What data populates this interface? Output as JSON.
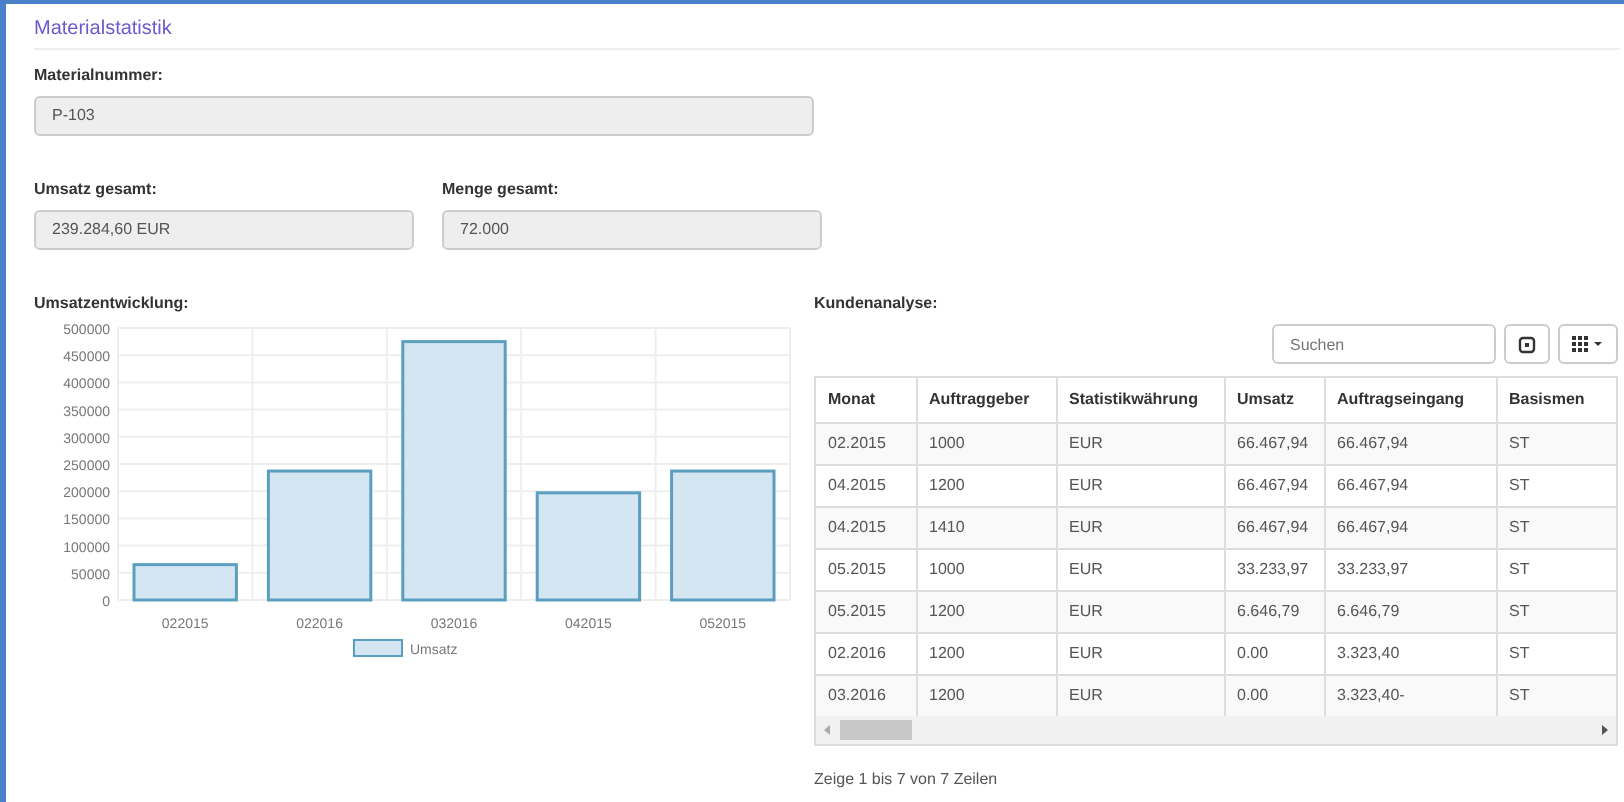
{
  "title": "Materialstatistik",
  "material": {
    "label": "Materialnummer:",
    "value": "P-103"
  },
  "totals": [
    {
      "label": "Umsatz gesamt:",
      "value": "239.284,60 EUR"
    },
    {
      "label": "Menge gesamt:",
      "value": "72.000"
    }
  ],
  "chart_section": {
    "label": "Umsatzentwicklung:",
    "chart_data": {
      "type": "bar",
      "categories": [
        "022015",
        "022016",
        "032016",
        "042015",
        "052015"
      ],
      "series": [
        {
          "name": "Umsatz",
          "color": "#d4e6f1",
          "values": [
            65000,
            237000,
            475000,
            197000,
            237000
          ]
        }
      ],
      "ylim": [
        0,
        500000
      ],
      "grid": true,
      "yticks": [
        0,
        50000,
        100000,
        150000,
        200000,
        250000,
        300000,
        350000,
        400000,
        450000,
        500000
      ]
    }
  },
  "customer_section": {
    "label": "Kundenanalyse:",
    "search": {
      "placeholder": "Suchen"
    },
    "table": {
      "columns": [
        "Monat",
        "Auftraggeber",
        "Statistikwährung",
        "Umsatz",
        "Auftragseingang",
        "Basismen"
      ],
      "rows": [
        [
          "02.2015",
          "1000",
          "EUR",
          "66.467,94",
          "66.467,94",
          "ST"
        ],
        [
          "04.2015",
          "1200",
          "EUR",
          "66.467,94",
          "66.467,94",
          "ST"
        ],
        [
          "04.2015",
          "1410",
          "EUR",
          "66.467,94",
          "66.467,94",
          "ST"
        ],
        [
          "05.2015",
          "1000",
          "EUR",
          "33.233,97",
          "33.233,97",
          "ST"
        ],
        [
          "05.2015",
          "1200",
          "EUR",
          "6.646,79",
          "6.646,79",
          "ST"
        ],
        [
          "02.2016",
          "1200",
          "EUR",
          "0.00",
          "3.323,40",
          "ST"
        ],
        [
          "03.2016",
          "1200",
          "EUR",
          "0.00",
          "3.323,40-",
          "ST"
        ]
      ]
    },
    "footer": "Zeige 1 bis 7 von 7 Zeilen"
  }
}
